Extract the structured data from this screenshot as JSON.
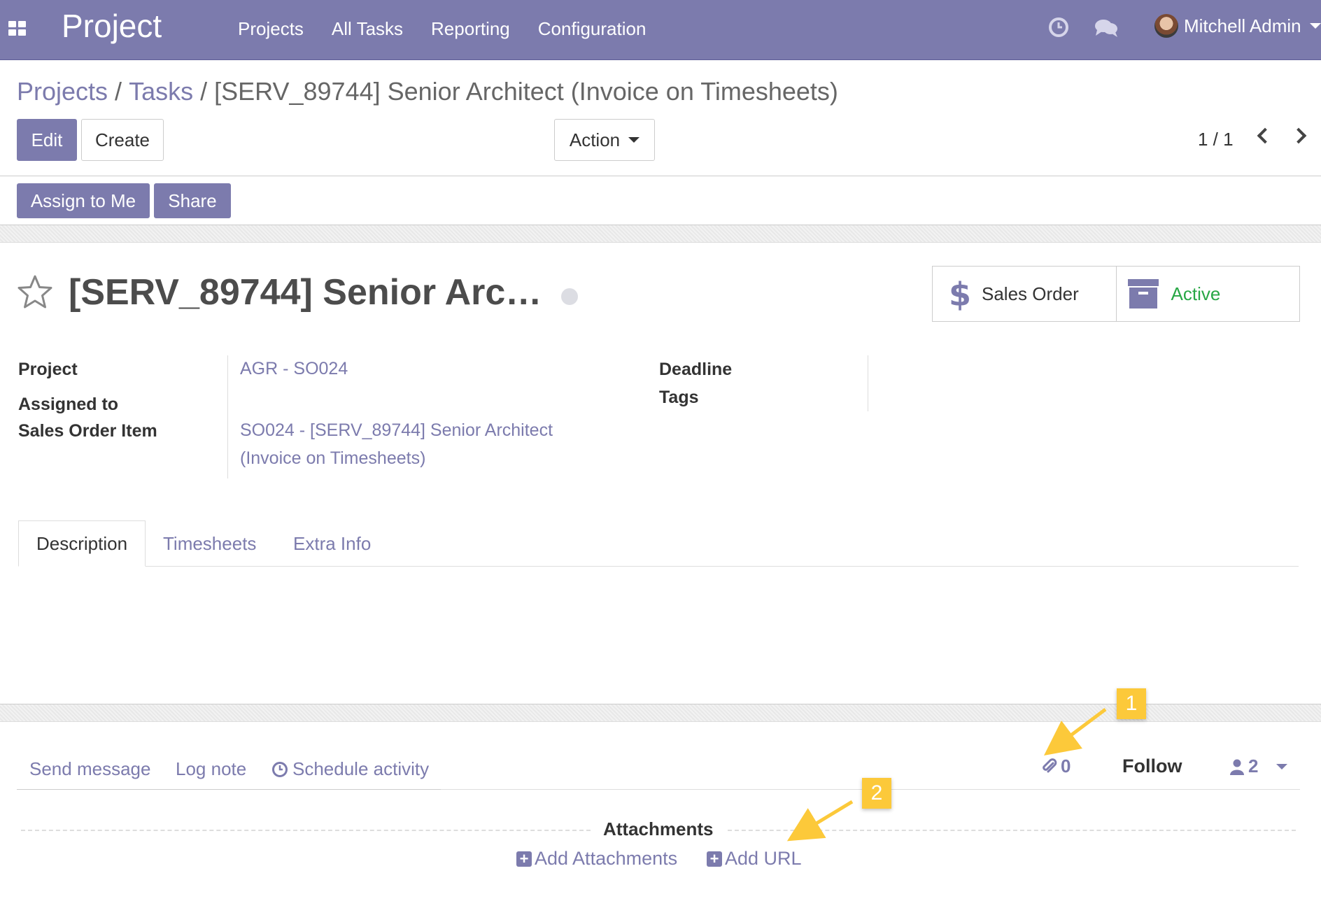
{
  "navbar": {
    "app_title": "Project",
    "menu": [
      "Projects",
      "All Tasks",
      "Reporting",
      "Configuration"
    ],
    "user_name": "Mitchell Admin",
    "bg_color": "#7c7bad"
  },
  "breadcrumb": {
    "items": [
      "Projects",
      "Tasks"
    ],
    "current": "[SERV_89744] Senior Architect (Invoice on Timesheets)"
  },
  "control_panel": {
    "edit_label": "Edit",
    "create_label": "Create",
    "action_label": "Action",
    "pager": "1 / 1"
  },
  "statusbar": {
    "assign_label": "Assign to Me",
    "share_label": "Share"
  },
  "form": {
    "title": "[SERV_89744] Senior Arc…",
    "smart_buttons": {
      "sales_order": "Sales Order",
      "active": "Active"
    },
    "fields": {
      "project_label": "Project",
      "project_value": "AGR - SO024",
      "assigned_label": "Assigned to",
      "sale_line_label": "Sales Order Item",
      "sale_line_value_1": "SO024 - [SERV_89744] Senior Architect",
      "sale_line_value_2": "(Invoice on Timesheets)",
      "deadline_label": "Deadline",
      "tags_label": "Tags"
    },
    "tabs": [
      "Description",
      "Timesheets",
      "Extra Info"
    ]
  },
  "chatter": {
    "send_message": "Send message",
    "log_note": "Log note",
    "schedule_activity": "Schedule activity",
    "attachment_count": "0",
    "follow_label": "Follow",
    "followers_count": "2",
    "attachments_title": "Attachments",
    "add_attachments": "Add Attachments",
    "add_url": "Add URL"
  },
  "callouts": [
    "1",
    "2"
  ],
  "colors": {
    "accent": "#7c7bad",
    "active_green": "#28a745",
    "callout_yellow": "#fcc93a"
  }
}
